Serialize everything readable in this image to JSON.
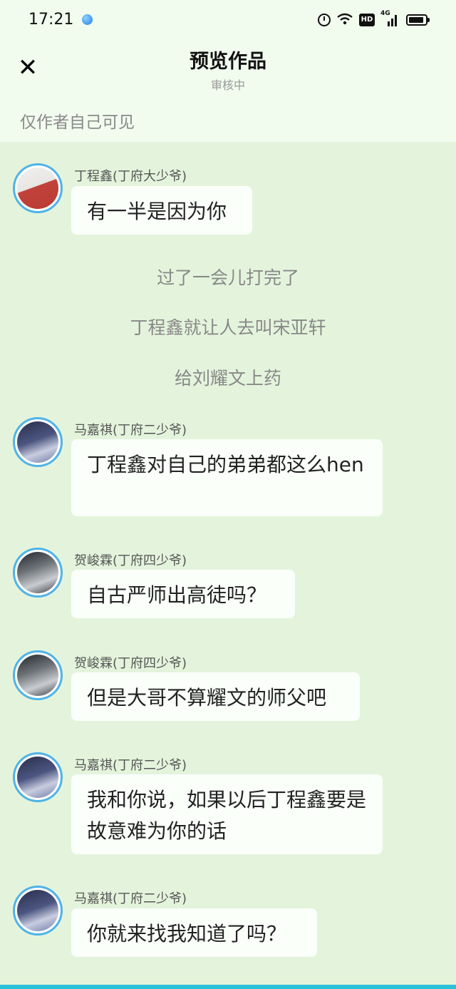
{
  "status_bar": {
    "time": "17:21",
    "network": "4G",
    "hd": "HD"
  },
  "header": {
    "title": "预览作品",
    "subtitle": "审核中",
    "close_icon": "close-icon",
    "visibility_note": "仅作者自己可见"
  },
  "messages": [
    {
      "type": "chat",
      "name": "丁程鑫(丁府大少爷)",
      "text": "有一半是因为你"
    },
    {
      "type": "narration",
      "text": "过了一会儿打完了"
    },
    {
      "type": "narration",
      "text": "丁程鑫就让人去叫宋亚轩"
    },
    {
      "type": "narration",
      "text": "给刘耀文上药"
    },
    {
      "type": "chat",
      "name": "马嘉祺(丁府二少爷)",
      "text": "丁程鑫对自己的弟弟都这么hen"
    },
    {
      "type": "chat",
      "name": "贺峻霖(丁府四少爷)",
      "text": "自古严师出高徒吗？"
    },
    {
      "type": "chat",
      "name": "贺峻霖(丁府四少爷)",
      "text": "但是大哥不算耀文的师父吧"
    },
    {
      "type": "chat",
      "name": "马嘉祺(丁府二少爷)",
      "text": "我和你说，如果以后丁程鑫要是故意难为你的话"
    },
    {
      "type": "chat",
      "name": "马嘉祺(丁府二少爷)",
      "text": "你就来找我知道了吗？"
    }
  ],
  "colors": {
    "background": "#e4f4dc",
    "header_bg": "#f1fbee",
    "bubble": "#fafffa",
    "avatar_ring": "#4fb3e8"
  }
}
